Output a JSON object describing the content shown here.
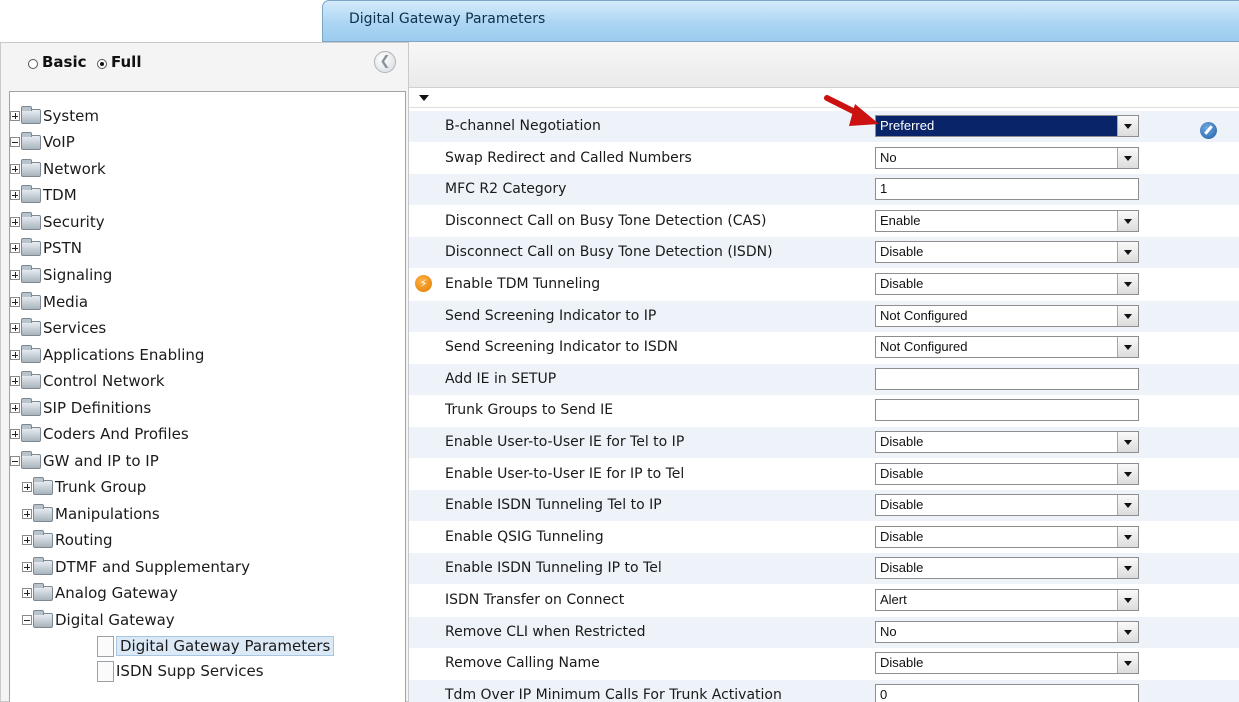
{
  "title": "Digital Gateway Parameters",
  "mode": {
    "basic_label": "Basic",
    "full_label": "Full",
    "selected": "Full"
  },
  "collapse_icon": "chevron-left-icon",
  "tree": [
    {
      "label": "System",
      "level": 0,
      "type": "folder",
      "state": "collapsed"
    },
    {
      "label": "VoIP",
      "level": 0,
      "type": "folder",
      "state": "expanded"
    },
    {
      "label": "Network",
      "level": 1,
      "type": "folder",
      "state": "collapsed"
    },
    {
      "label": "TDM",
      "level": 1,
      "type": "folder",
      "state": "collapsed"
    },
    {
      "label": "Security",
      "level": 1,
      "type": "folder",
      "state": "collapsed"
    },
    {
      "label": "PSTN",
      "level": 1,
      "type": "folder",
      "state": "collapsed"
    },
    {
      "label": "Signaling",
      "level": 1,
      "type": "folder",
      "state": "collapsed"
    },
    {
      "label": "Media",
      "level": 1,
      "type": "folder",
      "state": "collapsed"
    },
    {
      "label": "Services",
      "level": 1,
      "type": "folder",
      "state": "collapsed"
    },
    {
      "label": "Applications Enabling",
      "level": 1,
      "type": "folder",
      "state": "collapsed"
    },
    {
      "label": "Control Network",
      "level": 1,
      "type": "folder",
      "state": "collapsed"
    },
    {
      "label": "SIP Definitions",
      "level": 1,
      "type": "folder",
      "state": "collapsed"
    },
    {
      "label": "Coders And Profiles",
      "level": 1,
      "type": "folder",
      "state": "collapsed"
    },
    {
      "label": "GW and IP to IP",
      "level": 1,
      "type": "folder",
      "state": "expanded"
    },
    {
      "label": "Trunk Group",
      "level": 2,
      "type": "folder",
      "state": "collapsed"
    },
    {
      "label": "Manipulations",
      "level": 2,
      "type": "folder",
      "state": "collapsed"
    },
    {
      "label": "Routing",
      "level": 2,
      "type": "folder",
      "state": "collapsed"
    },
    {
      "label": "DTMF and Supplementary",
      "level": 2,
      "type": "folder",
      "state": "collapsed"
    },
    {
      "label": "Analog Gateway",
      "level": 2,
      "type": "folder",
      "state": "collapsed"
    },
    {
      "label": "Digital Gateway",
      "level": 2,
      "type": "folder",
      "state": "expanded"
    },
    {
      "label": "Digital Gateway Parameters",
      "level": 3,
      "type": "page",
      "selected": true
    },
    {
      "label": "ISDN Supp Services",
      "level": 3,
      "type": "page"
    }
  ],
  "params": [
    {
      "label": "B-channel Negotiation",
      "type": "select",
      "value": "Preferred",
      "highlighted": true,
      "edit_icon": "pencil-icon"
    },
    {
      "label": "Swap Redirect and Called Numbers",
      "type": "select",
      "value": "No"
    },
    {
      "label": "MFC R2 Category",
      "type": "text",
      "value": "1"
    },
    {
      "label": "Disconnect Call on Busy Tone Detection (CAS)",
      "type": "select",
      "value": "Enable"
    },
    {
      "label": "Disconnect Call on Busy Tone Detection (ISDN)",
      "type": "select",
      "value": "Disable"
    },
    {
      "label": "Enable TDM Tunneling",
      "type": "select",
      "value": "Disable",
      "icon": "lightning-icon"
    },
    {
      "label": "Send Screening Indicator to IP",
      "type": "select",
      "value": "Not Configured"
    },
    {
      "label": "Send Screening Indicator to ISDN",
      "type": "select",
      "value": "Not Configured"
    },
    {
      "label": "Add IE in SETUP",
      "type": "text",
      "value": ""
    },
    {
      "label": "Trunk Groups to Send IE",
      "type": "text",
      "value": ""
    },
    {
      "label": "Enable User-to-User IE for Tel to IP",
      "type": "select",
      "value": "Disable"
    },
    {
      "label": "Enable User-to-User IE for IP to Tel",
      "type": "select",
      "value": "Disable"
    },
    {
      "label": "Enable ISDN Tunneling Tel to IP",
      "type": "select",
      "value": "Disable"
    },
    {
      "label": "Enable QSIG Tunneling",
      "type": "select",
      "value": "Disable"
    },
    {
      "label": "Enable ISDN Tunneling IP to Tel",
      "type": "select",
      "value": "Disable"
    },
    {
      "label": "ISDN Transfer on Connect",
      "type": "select",
      "value": "Alert"
    },
    {
      "label": "Remove CLI when Restricted",
      "type": "select",
      "value": "No"
    },
    {
      "label": "Remove Calling Name",
      "type": "select",
      "value": "Disable"
    },
    {
      "label": "Tdm Over IP Minimum Calls For Trunk Activation",
      "type": "text",
      "value": "0"
    }
  ],
  "colors": {
    "accent": "#acd6f3",
    "selection": "#0a246a",
    "annotation_arrow": "#cc1111",
    "row_alt": "#eef3f9"
  }
}
